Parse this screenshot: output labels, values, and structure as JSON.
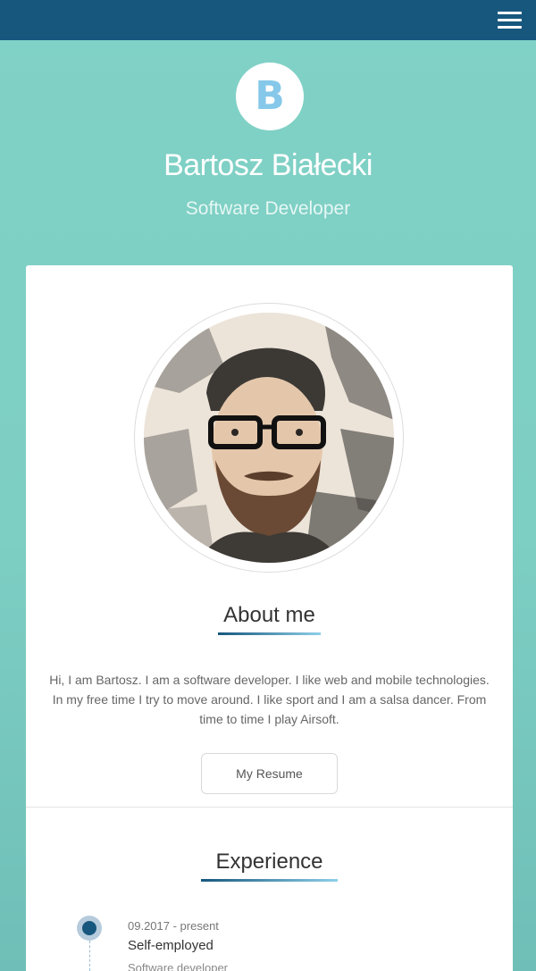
{
  "header": {
    "menu_icon": "hamburger-menu-icon",
    "bar_color": "#17577e"
  },
  "hero": {
    "logo_letter": "B",
    "name": "Bartosz Białecki",
    "role": "Software Developer"
  },
  "about": {
    "portrait": "portrait-sketch-image",
    "title": "About me",
    "text": "Hi, I am Bartosz. I am a software developer. I like web and mobile technologies. In my free time I try to move around. I like sport and I am a salsa dancer. From time to time I play Airsoft.",
    "resume_button": "My Resume"
  },
  "experience": {
    "title": "Experience",
    "items": [
      {
        "date": "09.2017 - present",
        "company": "Self-employed",
        "position": "Software developer"
      }
    ]
  },
  "colors": {
    "background": "#7fd0c5",
    "accent": "#17577e",
    "logo_letter": "#86c8ea"
  }
}
